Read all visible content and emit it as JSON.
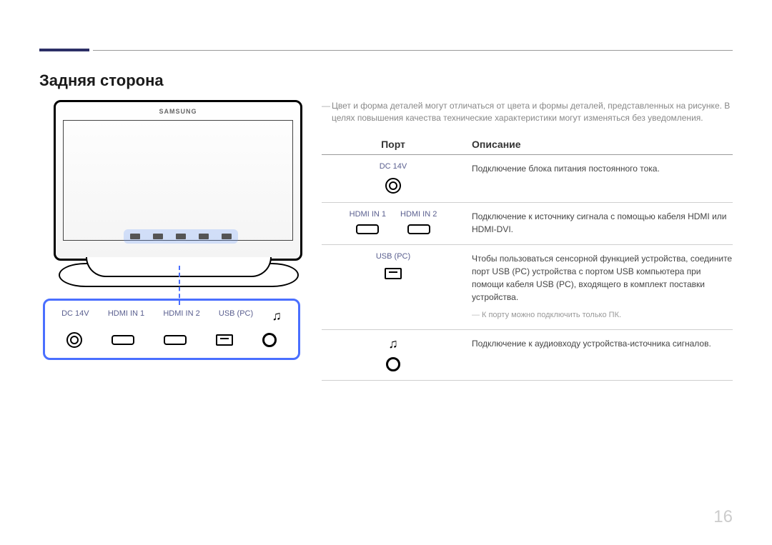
{
  "heading": "Задняя сторона",
  "page_number": "16",
  "brand": "SAMSUNG",
  "note_top": "Цвет и форма деталей могут отличаться от цвета и формы деталей, представленных на рисунке. В целях повышения качества технические характеристики могут изменяться без уведомления.",
  "table": {
    "header_port": "Порт",
    "header_desc": "Описание",
    "rows": [
      {
        "labels": [
          "DC 14V"
        ],
        "desc": "Подключение блока питания постоянного тока."
      },
      {
        "labels": [
          "HDMI IN 1",
          "HDMI IN 2"
        ],
        "desc": "Подключение к источнику сигнала с помощью кабеля HDMI или HDMI-DVI."
      },
      {
        "labels": [
          "USB (PC)"
        ],
        "desc": "Чтобы пользоваться сенсорной функцией устройства, соедините порт USB (PC) устройства с портом USB компьютера при помощи кабеля USB (PC), входящего в комплект поставки устройства.",
        "sub": "К порту можно подключить только ПК."
      },
      {
        "labels": [
          ""
        ],
        "desc": "Подключение к аудиовходу устройства-источника сигналов."
      }
    ]
  },
  "zoom_labels": {
    "dc": "DC 14V",
    "hdmi1": "HDMI IN 1",
    "hdmi2": "HDMI IN 2",
    "usb": "USB (PC)"
  }
}
